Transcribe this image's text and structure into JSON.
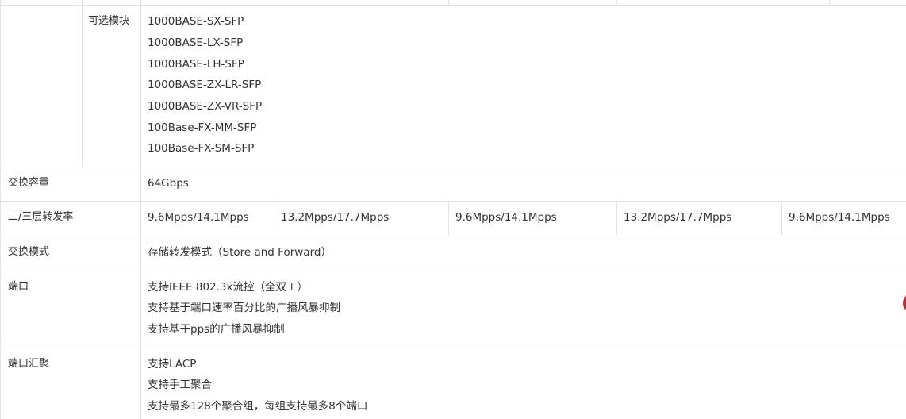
{
  "optional_modules": {
    "label": "可选模块",
    "items": [
      "1000BASE-SX-SFP",
      "1000BASE-LX-SFP",
      "1000BASE-LH-SFP",
      "1000BASE-ZX-LR-SFP",
      "1000BASE-ZX-VR-SFP",
      "100Base-FX-MM-SFP",
      "100Base-FX-SM-SFP"
    ]
  },
  "switching_capacity": {
    "label": "交换容量",
    "value": "64Gbps"
  },
  "forwarding_rate": {
    "label": "二/三层转发率",
    "values": [
      "9.6Mpps/14.1Mpps",
      "13.2Mpps/17.7Mpps",
      "9.6Mpps/14.1Mpps",
      "13.2Mpps/17.7Mpps",
      "9.6Mpps/14.1Mpps"
    ]
  },
  "switching_mode": {
    "label": "交换模式",
    "value": "存储转发模式（Store and Forward）"
  },
  "port": {
    "label": "端口",
    "lines": [
      "支持IEEE 802.3x流控（全双工）",
      "支持基于端口速率百分比的广播风暴抑制",
      "支持基于pps的广播风暴抑制"
    ]
  },
  "port_aggregation": {
    "label": "端口汇聚",
    "lines": [
      "支持LACP",
      "支持手工聚合",
      "支持最多128个聚合组，每组支持最多8个端口"
    ]
  },
  "colors": {
    "border": "#e3e3e3",
    "text": "#333333",
    "badge": "#d3232f"
  }
}
